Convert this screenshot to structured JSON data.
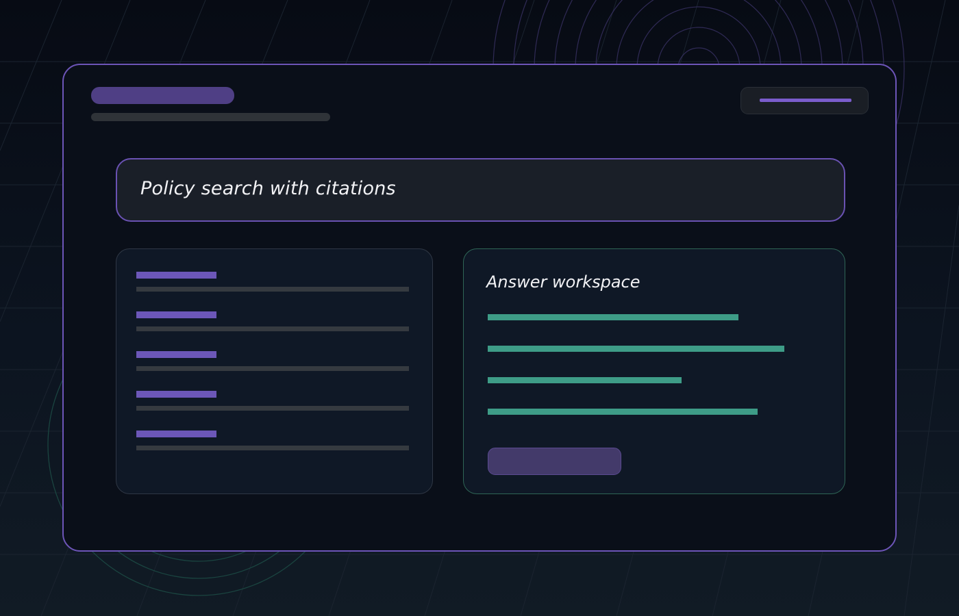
{
  "search": {
    "query": "Policy search with citations"
  },
  "answer": {
    "title": "Answer workspace",
    "line_fractions": [
      0.66,
      0.78,
      0.51,
      0.71
    ]
  },
  "sources": {
    "item_count": 5
  },
  "colors": {
    "accent": "#6d55b8",
    "answer_accent": "#3e9c87",
    "window_background": "#0a0f19",
    "panel_background": "#0f1826",
    "search_background": "#1a1f28"
  }
}
